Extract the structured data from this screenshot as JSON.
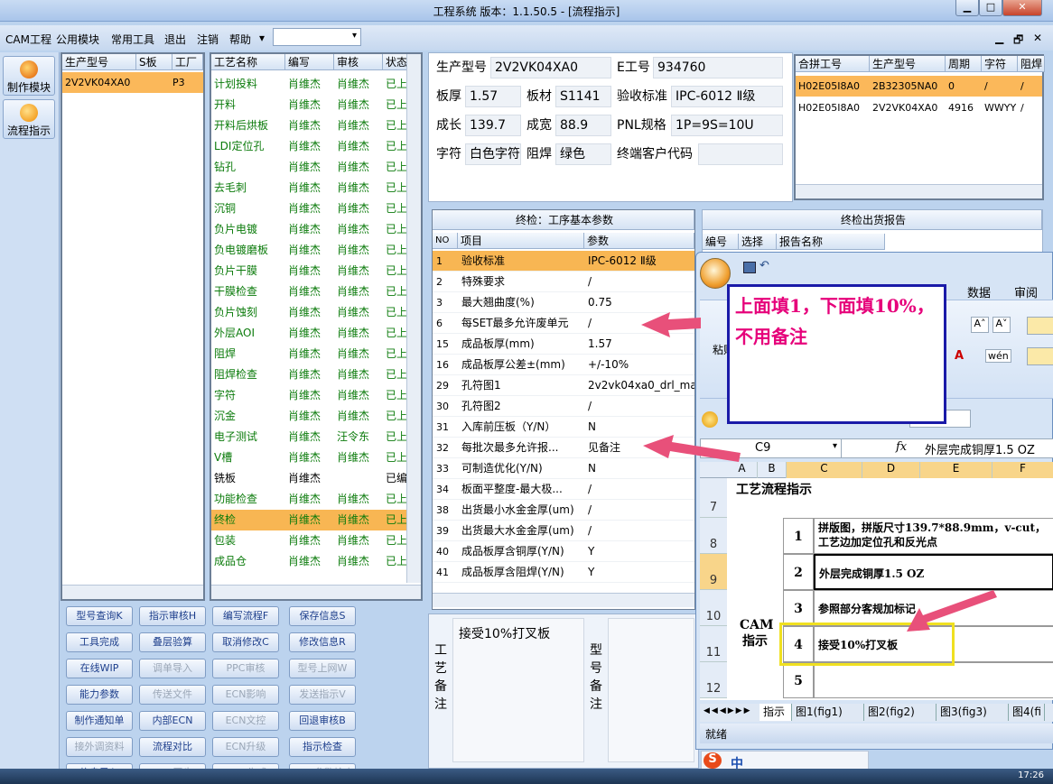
{
  "window": {
    "title": "工程系统   版本：1.1.50.5 - [流程指示]",
    "min": "▁",
    "max": "□",
    "close": "✕"
  },
  "menu": {
    "items": [
      "CAM工程",
      "公用模块",
      "常用工具",
      "退出",
      "注销",
      "帮助"
    ],
    "dropdown_arrow": "▾",
    "mdi": [
      "▁",
      "🗗",
      "✕"
    ]
  },
  "left_strip": {
    "buttons": [
      "制作模块",
      "流程指示"
    ]
  },
  "product_list": {
    "headers": [
      "生产型号",
      "S板",
      "工厂"
    ],
    "rows": [
      [
        "2V2VK04XA0",
        "",
        "P3"
      ]
    ]
  },
  "process_list": {
    "headers": [
      "工艺名称",
      "编写",
      "审核",
      "状态"
    ],
    "rows": [
      [
        "计划投料",
        "肖维杰",
        "肖维杰",
        "已上"
      ],
      [
        "开料",
        "肖维杰",
        "肖维杰",
        "已上"
      ],
      [
        "开料后烘板",
        "肖维杰",
        "肖维杰",
        "已上"
      ],
      [
        "LDI定位孔",
        "肖维杰",
        "肖维杰",
        "已上"
      ],
      [
        "钻孔",
        "肖维杰",
        "肖维杰",
        "已上"
      ],
      [
        "去毛刺",
        "肖维杰",
        "肖维杰",
        "已上"
      ],
      [
        "沉铜",
        "肖维杰",
        "肖维杰",
        "已上"
      ],
      [
        "负片电镀",
        "肖维杰",
        "肖维杰",
        "已上"
      ],
      [
        "负电镀磨板",
        "肖维杰",
        "肖维杰",
        "已上"
      ],
      [
        "负片干膜",
        "肖维杰",
        "肖维杰",
        "已上"
      ],
      [
        "干膜检查",
        "肖维杰",
        "肖维杰",
        "已上"
      ],
      [
        "负片蚀刻",
        "肖维杰",
        "肖维杰",
        "已上"
      ],
      [
        "外层AOI",
        "肖维杰",
        "肖维杰",
        "已上"
      ],
      [
        "阻焊",
        "肖维杰",
        "肖维杰",
        "已上"
      ],
      [
        "阻焊检查",
        "肖维杰",
        "肖维杰",
        "已上"
      ],
      [
        "字符",
        "肖维杰",
        "肖维杰",
        "已上"
      ],
      [
        "沉金",
        "肖维杰",
        "肖维杰",
        "已上"
      ],
      [
        "电子测试",
        "肖维杰",
        "汪令东",
        "已上"
      ],
      [
        "V槽",
        "肖维杰",
        "肖维杰",
        "已上"
      ],
      [
        "铣板",
        "肖维杰",
        "",
        "已编"
      ],
      [
        "功能检查",
        "肖维杰",
        "肖维杰",
        "已上"
      ],
      [
        "终检",
        "肖维杰",
        "肖维杰",
        "已上"
      ],
      [
        "包装",
        "肖维杰",
        "肖维杰",
        "已上"
      ],
      [
        "成品仓",
        "肖维杰",
        "肖维杰",
        "已上"
      ]
    ]
  },
  "info": {
    "prod_model_label": "生产型号",
    "prod_model": "2V2VK04XA0",
    "e_no_label": "E工号",
    "e_no": "934760",
    "thick_label": "板厚",
    "thick": "1.57",
    "material_label": "板材",
    "material": "S1141",
    "accept_label": "验收标准",
    "accept": "IPC-6012 Ⅱ级",
    "len_label": "成长",
    "len": "139.7",
    "width_label": "成宽",
    "width": "88.9",
    "pnl_label": "PNL规格",
    "pnl": "1P=9S=10U",
    "char_label": "字符",
    "char": "白色字符",
    "mask_label": "阻焊",
    "mask": "绿色",
    "client_label": "终端客户代码",
    "client": ""
  },
  "merge_table": {
    "headers": [
      "合拼工号",
      "生产型号",
      "周期",
      "字符",
      "阻焊"
    ],
    "rows": [
      [
        "H02E05I8A0",
        "2B32305NA0",
        "0",
        "/",
        "/"
      ],
      [
        "H02E05I8A0",
        "2V2VK04XA0",
        "4916",
        "WWYY",
        "/"
      ]
    ]
  },
  "params": {
    "title": "终检：工序基本参数",
    "headers": [
      "NO",
      "项目",
      "参数"
    ],
    "rows": [
      [
        "1",
        "验收标准",
        "IPC-6012 Ⅱ级"
      ],
      [
        "2",
        "特殊要求",
        "/"
      ],
      [
        "3",
        "最大翘曲度(%)",
        "0.75"
      ],
      [
        "6",
        "每SET最多允许废单元",
        "/"
      ],
      [
        "15",
        "成品板厚(mm)",
        "1.57"
      ],
      [
        "16",
        "成品板厚公差±(mm)",
        "+/-10%"
      ],
      [
        "29",
        "孔符图1",
        "2v2vk04xa0_drl_ma"
      ],
      [
        "30",
        "孔符图2",
        "/"
      ],
      [
        "31",
        "入库前压板（Y/N）",
        "N"
      ],
      [
        "32",
        "每批次最多允许报...",
        "见备注"
      ],
      [
        "33",
        "可制造优化(Y/N)",
        "N"
      ],
      [
        "34",
        "板面平整度-最大极...",
        "/"
      ],
      [
        "38",
        "出货最小水金金厚(um)",
        "/"
      ],
      [
        "39",
        "出货最大水金金厚(um)",
        "/"
      ],
      [
        "40",
        "成品板厚含铜厚(Y/N)",
        "Y"
      ],
      [
        "41",
        "成品板厚含阻焊(Y/N)",
        "Y"
      ]
    ]
  },
  "report": {
    "title": "终检出货报告",
    "headers": [
      "编号",
      "选择",
      "报告名称"
    ]
  },
  "buttons": [
    [
      "型号查询K",
      "指示审核H",
      "编写流程F",
      "保存信息S"
    ],
    [
      "工具完成",
      "叠层验算",
      "取消修改C",
      "修改信息R"
    ],
    [
      "在线WIP",
      "调单导入",
      "PPC审核",
      "型号上网W"
    ],
    [
      "能力参数",
      "传送文件",
      "ECN影响",
      "发送指示V"
    ],
    [
      "制作通知单",
      "内部ECN",
      "ECN文控",
      "回退审核B"
    ],
    [
      "接外调资料",
      "流程对比",
      "ECN升级",
      "指示检查"
    ],
    [
      "信息导入",
      "MPS同步",
      "BOM生成",
      "BOM参数检查"
    ]
  ],
  "notes": {
    "process_label": "工艺备注",
    "process_text": "接受10%打叉板",
    "model_label": "型号备注",
    "model_text": ""
  },
  "callout": {
    "text": "上面填1，下面填10%，不用备注"
  },
  "excel": {
    "tabs_ribbon": [
      "数据",
      "审阅"
    ],
    "paste_label": "粘贴",
    "namebox": "C9",
    "fx": "fx",
    "formula": "外层完成铜厚1.5 OZ",
    "columns": [
      "A",
      "B",
      "C",
      "D",
      "E",
      "F"
    ],
    "row_numbers": [
      "7",
      "8",
      "9",
      "10",
      "11",
      "12"
    ],
    "flow_title": "工艺流程指示",
    "cam_label": "CAM指示",
    "items": [
      {
        "no": "1",
        "text": "拼版图，拼版尺寸139.7*88.9mm，v-cut，工艺边加定位孔和反光点"
      },
      {
        "no": "2",
        "text": "外层完成铜厚1.5 OZ"
      },
      {
        "no": "3",
        "text": "参照部分客规加标记"
      },
      {
        "no": "4",
        "text": "接受10%打叉板"
      },
      {
        "no": "5",
        "text": ""
      }
    ],
    "sheet_tabs": [
      "指示",
      "图1(fig1)",
      "图2(fig2)",
      "图3(fig3)",
      "图4(fi"
    ],
    "status": "就绪"
  },
  "ime": {
    "text": "中"
  },
  "clock": "17:26",
  "colors": {
    "selected_row": "#f8b653",
    "callout_border": "#1a1aa8",
    "callout_text": "#e6007a",
    "arrow": "#e8507a",
    "highlight_box": "#f0e020"
  }
}
